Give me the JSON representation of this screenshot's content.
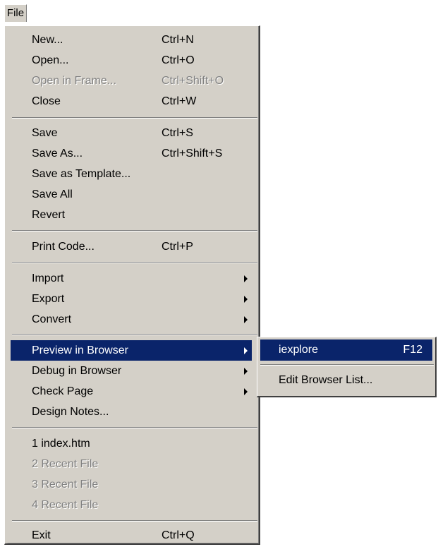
{
  "menubar": {
    "file_label": "File"
  },
  "menu": {
    "items": [
      {
        "label": "New...",
        "shortcut": "Ctrl+N"
      },
      {
        "label": "Open...",
        "shortcut": "Ctrl+O"
      },
      {
        "label": "Open in Frame...",
        "shortcut": "Ctrl+Shift+O"
      },
      {
        "label": "Close",
        "shortcut": "Ctrl+W"
      },
      {
        "label": "Save",
        "shortcut": "Ctrl+S"
      },
      {
        "label": "Save As...",
        "shortcut": "Ctrl+Shift+S"
      },
      {
        "label": "Save as Template...",
        "shortcut": ""
      },
      {
        "label": "Save All",
        "shortcut": ""
      },
      {
        "label": "Revert",
        "shortcut": ""
      },
      {
        "label": "Print Code...",
        "shortcut": "Ctrl+P"
      },
      {
        "label": "Import",
        "shortcut": ""
      },
      {
        "label": "Export",
        "shortcut": ""
      },
      {
        "label": "Convert",
        "shortcut": ""
      },
      {
        "label": "Preview in Browser",
        "shortcut": ""
      },
      {
        "label": "Debug in Browser",
        "shortcut": ""
      },
      {
        "label": "Check Page",
        "shortcut": ""
      },
      {
        "label": "Design Notes...",
        "shortcut": ""
      },
      {
        "label": "1 index.htm",
        "shortcut": ""
      },
      {
        "label": "2 Recent File",
        "shortcut": ""
      },
      {
        "label": "3 Recent File",
        "shortcut": ""
      },
      {
        "label": "4 Recent File",
        "shortcut": ""
      },
      {
        "label": "Exit",
        "shortcut": "Ctrl+Q"
      }
    ]
  },
  "submenu": {
    "items": [
      {
        "label": "iexplore",
        "shortcut": "F12"
      },
      {
        "label": "Edit Browser List...",
        "shortcut": ""
      }
    ]
  },
  "colors": {
    "menu_background": "#d4d0c8",
    "highlight": "#0a246a",
    "disabled_text": "#808080"
  }
}
